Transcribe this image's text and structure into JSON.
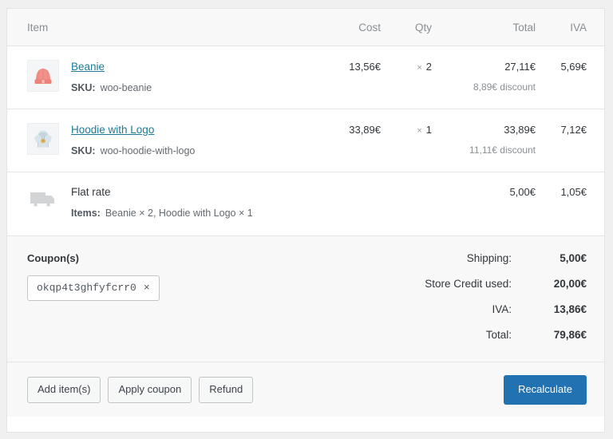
{
  "table": {
    "headers": {
      "item": "Item",
      "cost": "Cost",
      "qty": "Qty",
      "total": "Total",
      "iva": "IVA"
    }
  },
  "line_items": [
    {
      "name": "Beanie",
      "thumb_icon": "beanie-thumbnail",
      "meta_label": "SKU:",
      "meta_value": "woo-beanie",
      "cost": "13,56€",
      "qty_symbol": "×",
      "qty": "2",
      "total": "27,11€",
      "discount": "8,89€ discount",
      "iva": "5,69€"
    },
    {
      "name": "Hoodie with Logo",
      "thumb_icon": "hoodie-thumbnail",
      "meta_label": "SKU:",
      "meta_value": "woo-hoodie-with-logo",
      "cost": "33,89€",
      "qty_symbol": "×",
      "qty": "1",
      "total": "33,89€",
      "discount": "11,11€ discount",
      "iva": "7,12€"
    }
  ],
  "shipping_item": {
    "name": "Flat rate",
    "thumb_icon": "shipping-truck-icon",
    "meta_label": "Items:",
    "meta_value": "Beanie × 2, Hoodie with Logo × 1",
    "total": "5,00€",
    "iva": "1,05€"
  },
  "coupons": {
    "title": "Coupon(s)",
    "chips": [
      {
        "code": "okqp4t3ghfyfcrr0",
        "remove_glyph": "×"
      }
    ]
  },
  "totals": [
    {
      "label": "Shipping:",
      "value": "5,00€"
    },
    {
      "label": "Store Credit used:",
      "value": "20,00€"
    },
    {
      "label": "IVA:",
      "value": "13,86€"
    },
    {
      "label": "Total:",
      "value": "79,86€"
    }
  ],
  "footer": {
    "add_items": "Add item(s)",
    "apply_coupon": "Apply coupon",
    "refund": "Refund",
    "recalculate": "Recalculate"
  },
  "colors": {
    "link": "#1d7a96",
    "primary_button": "#2271b1",
    "panel_bg": "#ffffff",
    "header_bg": "#f8f8f8",
    "page_bg": "#f0f0f1",
    "border": "#e5e5e5",
    "muted_text": "#8a8f94"
  }
}
